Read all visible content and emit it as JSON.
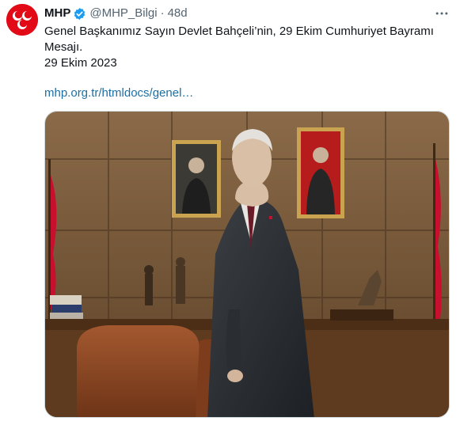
{
  "account": {
    "display_name": "MHP",
    "handle": "@MHP_Bilgi",
    "separator": "·",
    "time": "48d",
    "verified_icon": "verified-badge-icon",
    "avatar_logo": "mhp-crescent-logo"
  },
  "tweet": {
    "text_line": "Genel Başkanımız Sayın Devlet Bahçeli’nin, 29 Ekim Cumhuriyet Bayramı Mesajı.",
    "date_line": "29 Ekim 2023",
    "link": "mhp.org.tr/htmldocs/genel…"
  },
  "media": {
    "description_icon": "portrait-photo",
    "flag_color": "#c8102e"
  },
  "colors": {
    "accent_link": "#1d6fa3",
    "verified": "#1d9bf0",
    "avatar_bg": "#e30a17",
    "muted_text": "#536471"
  },
  "icons": {
    "more": "more-horizontal-icon"
  }
}
